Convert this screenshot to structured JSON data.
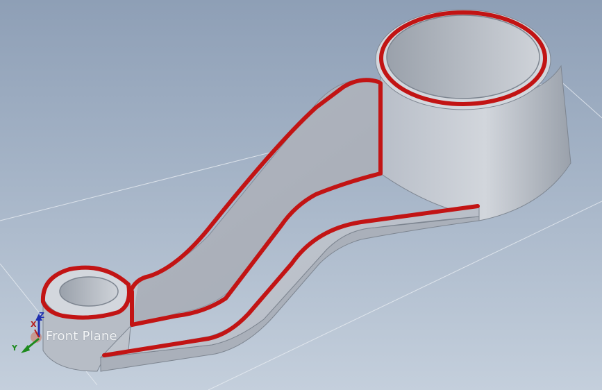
{
  "viewport": {
    "plane_label": "Front Plane",
    "triad": {
      "x": "X",
      "y": "Y",
      "z": "Z"
    }
  },
  "colors": {
    "background_top": "#8e9fb6",
    "background_bottom": "#c4cfdc",
    "part_face": "#c7ccd4",
    "part_dark": "#8f96a1",
    "selected_edge": "#c21414",
    "axis_x": "#b41c1c",
    "axis_y": "#1d8a1d",
    "axis_z": "#1f2fb0"
  },
  "icons": [
    "coordinate-triad-icon"
  ]
}
